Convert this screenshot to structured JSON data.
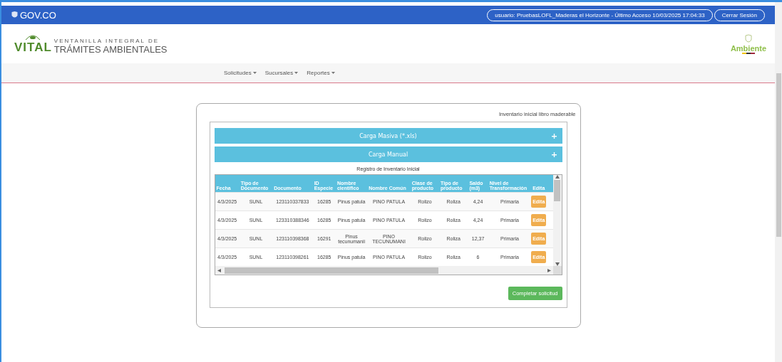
{
  "topbar": {
    "brand": "GOV.CO",
    "user_info": "usuario: PruebasLOFL_Maderas el Horizonte - Último Acceso 10/03/2025 17:04:33",
    "logout": "Cerrar Sesión"
  },
  "header": {
    "logo_top": "VENTANILLA INTEGRAL DE",
    "logo_word": "VITAL",
    "logo_bottom": "TRÁMITES AMBIENTALES",
    "ministry": "Ambiente"
  },
  "nav": [
    "Solicitudes",
    "Sucursales",
    "Reportes"
  ],
  "card": {
    "title": "Inventario inicial libro maderable",
    "panels": [
      {
        "label": "Carga Masiva (*.xls)",
        "expanded": false
      },
      {
        "label": "Carga Manual",
        "expanded": false
      }
    ],
    "table": {
      "caption": "Registro de Inventario Inicial",
      "columns": [
        "Fecha",
        "Tipo de Documento",
        "Documento",
        "ID Especie",
        "Nombre científico",
        "Nombre Común",
        "Clase de producto",
        "Tipo de producto",
        "Saldo (m3)",
        "Nivel de Transformación",
        "Edita"
      ],
      "rows": [
        {
          "cells": [
            "4/3/2025",
            "SUNL",
            "123110337833",
            "16285",
            "Pinus patula",
            "PINO PATULA",
            "Rolizo",
            "Roliza",
            "4,24",
            "Primaria"
          ],
          "action": "Edita"
        },
        {
          "cells": [
            "4/3/2025",
            "SUNL",
            "123310388346",
            "16285",
            "Pinus patula",
            "PINO PATULA",
            "Rolizo",
            "Roliza",
            "4,24",
            "Primaria"
          ],
          "action": "Edita"
        },
        {
          "cells": [
            "4/3/2025",
            "SUNL",
            "123110398368",
            "16291",
            "Pinus tecunumanii",
            "PINO TECUNUMANI",
            "Rolizo",
            "Roliza",
            "12,37",
            "Primaria"
          ],
          "action": "Edita"
        },
        {
          "cells": [
            "4/3/2025",
            "SUNL",
            "123110398261",
            "16285",
            "Pinus patula",
            "PINO PATULA",
            "Rolizo",
            "Roliza",
            "6",
            "Primaria"
          ],
          "action": "Edita"
        }
      ]
    },
    "submit": "Completar solicitud"
  }
}
